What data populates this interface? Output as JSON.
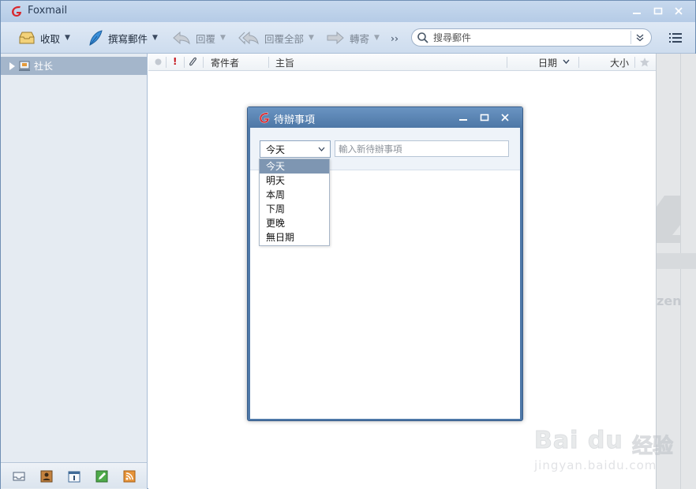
{
  "app": {
    "title": "Foxmail"
  },
  "toolbar": {
    "receive_label": "收取",
    "compose_label": "撰寫郵件",
    "reply_label": "回覆",
    "reply_all_label": "回覆全部",
    "forward_label": "轉寄",
    "more_label": "››"
  },
  "search": {
    "placeholder": "搜尋郵件"
  },
  "sidebar": {
    "account_name": "社长"
  },
  "mail_list": {
    "columns": {
      "flag": "!",
      "sender": "寄件者",
      "subject": "主旨",
      "date": "日期",
      "size": "大小"
    }
  },
  "todo_dialog": {
    "title": "待辦事項",
    "due_select": {
      "selected": "今天",
      "options": [
        "今天",
        "明天",
        "本周",
        "下周",
        "更晚",
        "無日期"
      ]
    },
    "new_task_placeholder": "輸入新待辦事項"
  },
  "right_pane": {
    "partial_text": "zen"
  },
  "watermark": {
    "brand": "Bai du",
    "cn": "经验",
    "url": "jingyan.baidu.com"
  },
  "colors": {
    "accent": "#4e78a8",
    "titlebar": "#b5cbe6",
    "selected_option": "#7e96b2",
    "sidebar_account": "#a4b6cb"
  }
}
